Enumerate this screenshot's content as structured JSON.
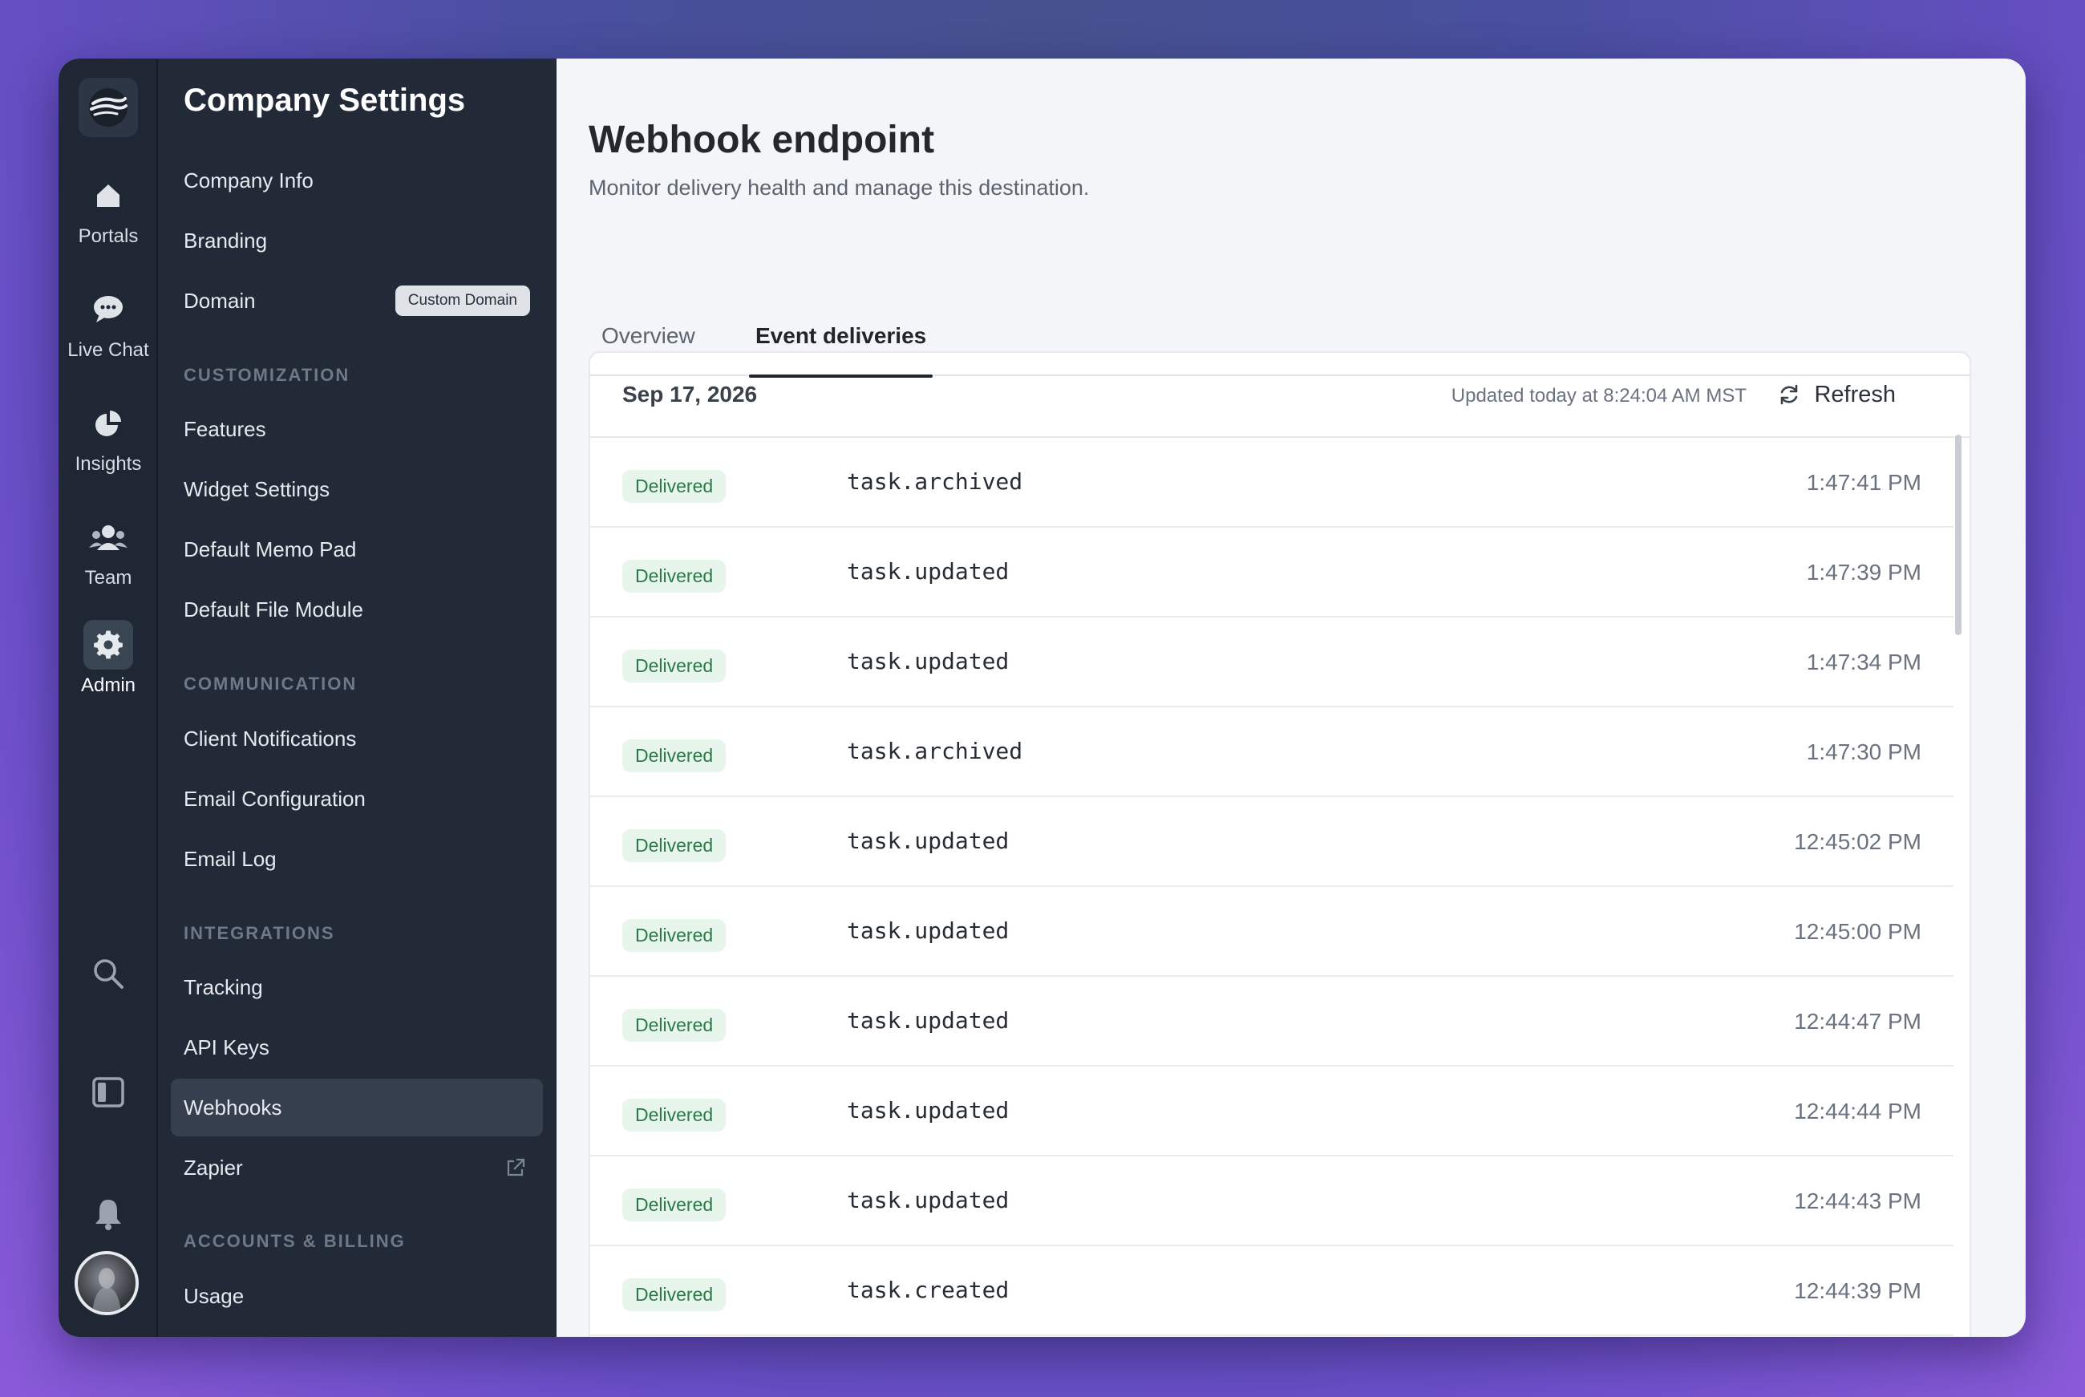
{
  "rail": {
    "items": [
      {
        "label": "Portals",
        "icon": "home-icon"
      },
      {
        "label": "Live Chat",
        "icon": "chat-bubble-icon"
      },
      {
        "label": "Insights",
        "icon": "pie-chart-icon"
      },
      {
        "label": "Team",
        "icon": "team-icon"
      },
      {
        "label": "Admin",
        "icon": "gear-icon"
      }
    ]
  },
  "sidebar": {
    "title": "Company Settings",
    "items": [
      {
        "label": "Company Info"
      },
      {
        "label": "Branding"
      },
      {
        "label": "Domain",
        "badge": "Custom Domain"
      },
      {
        "section": "CUSTOMIZATION"
      },
      {
        "label": "Features"
      },
      {
        "label": "Widget Settings"
      },
      {
        "label": "Default Memo Pad"
      },
      {
        "label": "Default File Module"
      },
      {
        "section": "COMMUNICATION"
      },
      {
        "label": "Client Notifications"
      },
      {
        "label": "Email Configuration"
      },
      {
        "label": "Email Log"
      },
      {
        "section": "INTEGRATIONS"
      },
      {
        "label": "Tracking"
      },
      {
        "label": "API Keys"
      },
      {
        "label": "Webhooks",
        "active": true
      },
      {
        "label": "Zapier",
        "external": true
      },
      {
        "section": "ACCOUNTS & BILLING"
      },
      {
        "label": "Usage"
      }
    ]
  },
  "main": {
    "title": "Webhook endpoint",
    "subtitle": "Monitor delivery health and manage this destination.",
    "tabs": [
      {
        "label": "Overview"
      },
      {
        "label": "Event deliveries",
        "active": true
      }
    ],
    "card": {
      "date": "Sep 17, 2026",
      "updated": "Updated today at 8:24:04 AM MST",
      "refresh_label": "Refresh"
    },
    "deliveries": [
      {
        "status": "Delivered",
        "event": "task.archived",
        "time": "1:47:41 PM"
      },
      {
        "status": "Delivered",
        "event": "task.updated",
        "time": "1:47:39 PM"
      },
      {
        "status": "Delivered",
        "event": "task.updated",
        "time": "1:47:34 PM"
      },
      {
        "status": "Delivered",
        "event": "task.archived",
        "time": "1:47:30 PM"
      },
      {
        "status": "Delivered",
        "event": "task.updated",
        "time": "12:45:02 PM"
      },
      {
        "status": "Delivered",
        "event": "task.updated",
        "time": "12:45:00 PM"
      },
      {
        "status": "Delivered",
        "event": "task.updated",
        "time": "12:44:47 PM"
      },
      {
        "status": "Delivered",
        "event": "task.updated",
        "time": "12:44:44 PM"
      },
      {
        "status": "Delivered",
        "event": "task.updated",
        "time": "12:44:43 PM"
      },
      {
        "status": "Delivered",
        "event": "task.created",
        "time": "12:44:39 PM"
      }
    ]
  },
  "colors": {
    "rail_bg": "#1e2733",
    "sidebar_bg": "#212a36",
    "status_bg": "#e8f5ec",
    "status_text": "#2a7a45"
  }
}
